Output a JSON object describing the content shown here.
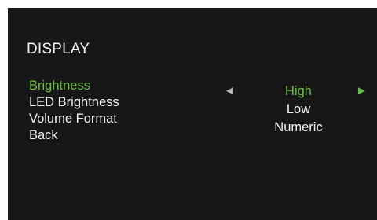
{
  "screen": {
    "title": "DISPLAY",
    "menu_items": [
      {
        "label": "Brightness",
        "selected": true
      },
      {
        "label": "LED Brightness",
        "selected": false
      },
      {
        "label": "Volume Format",
        "selected": false
      },
      {
        "label": "Back",
        "selected": false
      }
    ],
    "values": [
      {
        "label": "High",
        "selected": true
      },
      {
        "label": "Low",
        "selected": false
      },
      {
        "label": "Numeric",
        "selected": false
      }
    ],
    "arrows": {
      "left": "◄",
      "right": "►"
    },
    "colors": {
      "background": "#171717",
      "text": "#f2f2f2",
      "selected": "#6cbd45",
      "inactive_arrow": "#bdbdbd"
    },
    "icons": {
      "left_arrow": "left-arrow-icon",
      "right_arrow": "right-arrow-icon"
    }
  }
}
